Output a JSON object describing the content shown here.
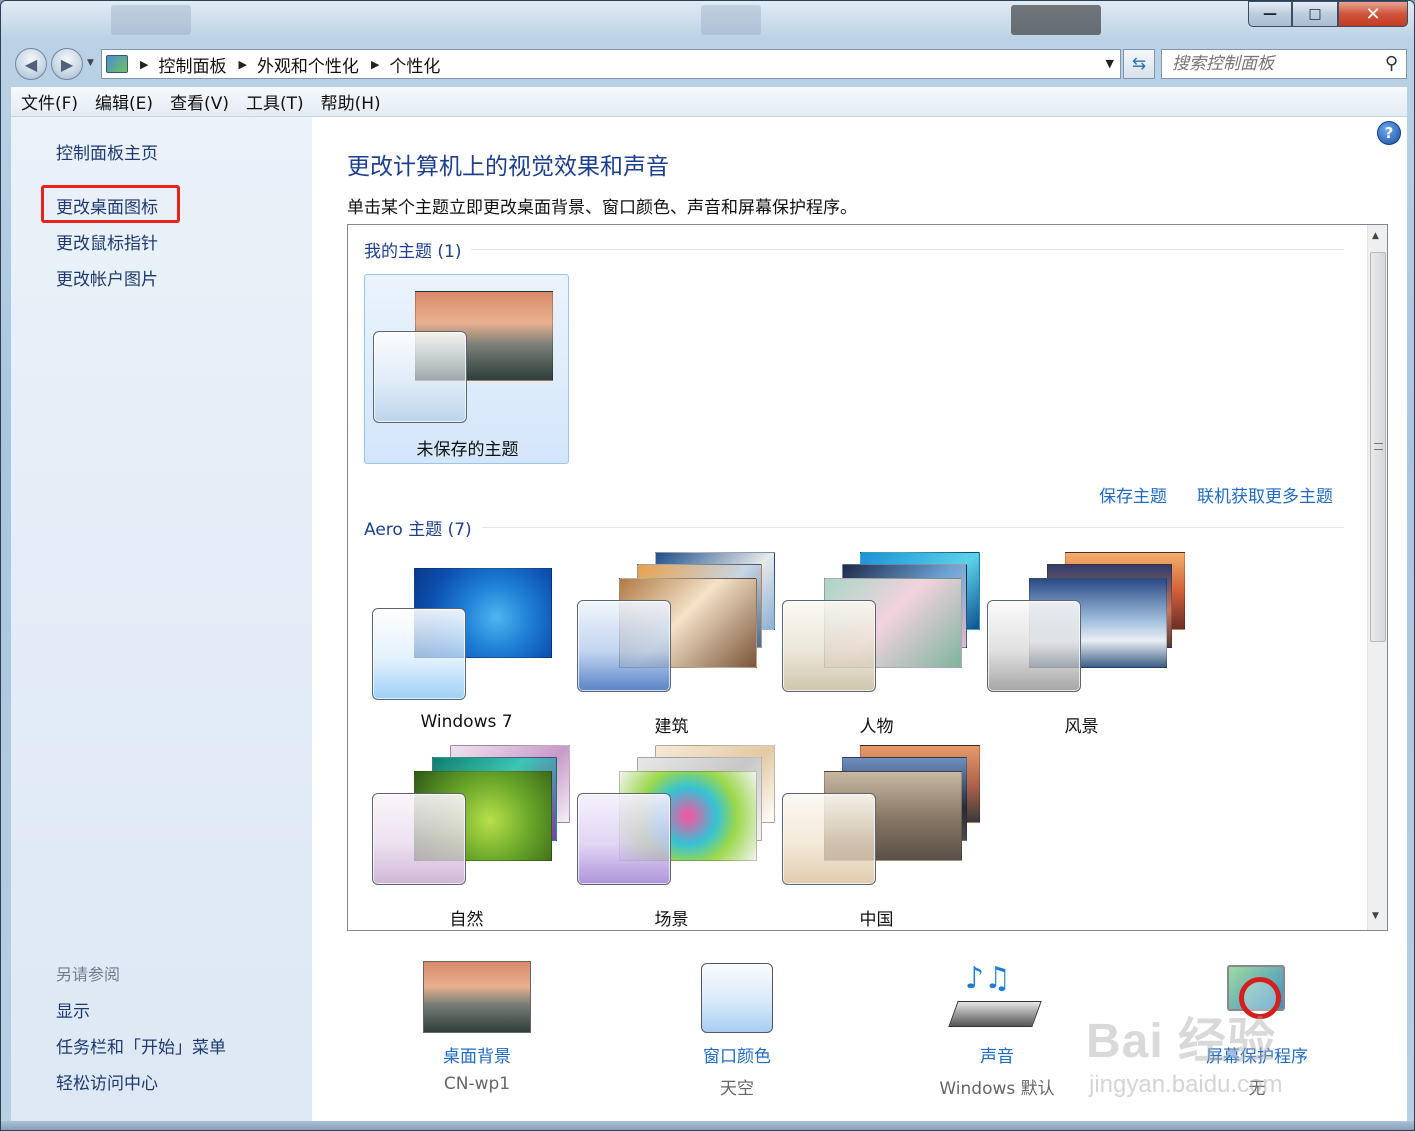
{
  "window": {
    "controls": {
      "minimize": "—",
      "maximize": "□",
      "close": "✕"
    }
  },
  "nav": {
    "breadcrumbs": [
      "控制面板",
      "外观和个性化",
      "个性化"
    ],
    "search_placeholder": "搜索控制面板"
  },
  "menubar": [
    "文件(F)",
    "编辑(E)",
    "查看(V)",
    "工具(T)",
    "帮助(H)"
  ],
  "sidebar": {
    "home": "控制面板主页",
    "tasks": [
      "更改桌面图标",
      "更改鼠标指针",
      "更改帐户图片"
    ],
    "highlighted_task": "更改桌面图标",
    "highlight_color": "#e8231b",
    "see_also_title": "另请参阅",
    "see_also": [
      "显示",
      "任务栏和「开始」菜单",
      "轻松访问中心"
    ]
  },
  "main": {
    "title": "更改计算机上的视觉效果和声音",
    "subtitle": "单击某个主题立即更改桌面背景、窗口颜色、声音和屏幕保护程序。",
    "my_themes_header": "我的主题 (1)",
    "my_themes": [
      {
        "name": "未保存的主题",
        "selected": true
      }
    ],
    "save_theme_link": "保存主题",
    "get_more_link": "联机获取更多主题",
    "aero_header": "Aero 主题 (7)",
    "aero_themes": [
      {
        "name": "Windows 7"
      },
      {
        "name": "建筑"
      },
      {
        "name": "人物"
      },
      {
        "name": "风景"
      },
      {
        "name": "自然"
      },
      {
        "name": "场景"
      },
      {
        "name": "中国"
      }
    ]
  },
  "settings": [
    {
      "name": "桌面背景",
      "value": "CN-wp1",
      "icon": "wallpaper-thumbnail-icon"
    },
    {
      "name": "窗口颜色",
      "value": "天空",
      "icon": "window-color-swatch-icon"
    },
    {
      "name": "声音",
      "value": "Windows 默认",
      "icon": "sound-keyboard-notes-icon"
    },
    {
      "name": "屏幕保护程序",
      "value": "无",
      "icon": "screensaver-none-icon"
    }
  ],
  "watermark": {
    "line1": "Bai 经验",
    "line2": "jingyan.baidu.com"
  },
  "colors": {
    "link": "#1f6ac2",
    "title": "#1e3f8f",
    "selection": "#d4e6fa"
  }
}
